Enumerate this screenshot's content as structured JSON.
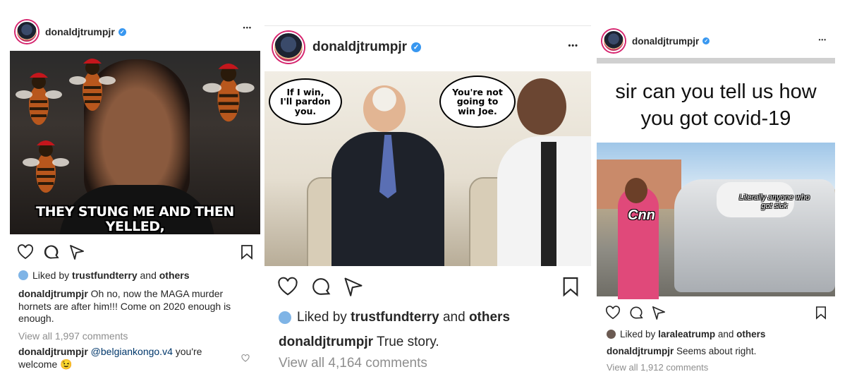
{
  "posts": [
    {
      "username": "donaldjtrumpjr",
      "more": "•••",
      "meme_caption": "THEY STUNG ME AND THEN YELLED,\n\"THIS IS MAGA COUNTRY!\"",
      "liked_prefix": "Liked by",
      "liked_user": "trustfundterry",
      "liked_and": "and",
      "liked_others": "others",
      "caption_user": "donaldjtrumpjr",
      "caption_text": "Oh no, now the MAGA murder hornets are after him!!! Come on 2020 enough is enough.",
      "view_all": "View all 1,997 comments",
      "comment_user": "donaldjtrumpjr",
      "comment_mention": "@belgiankongo.v4",
      "comment_text": "you're welcome 😉"
    },
    {
      "username": "donaldjtrumpjr",
      "more": "•••",
      "bubble_left": "If I win, I'll pardon you.",
      "bubble_right": "You're not going to win Joe.",
      "liked_prefix": "Liked by",
      "liked_user": "trustfundterry",
      "liked_and": "and",
      "liked_others": "others",
      "caption_user": "donaldjtrumpjr",
      "caption_text": "True story.",
      "view_all": "View all 4,164 comments"
    },
    {
      "username": "donaldjtrumpjr",
      "more": "•••",
      "meme_title": "sir can you tell us how you got covid-19",
      "label_cnn": "Cnn",
      "label_sick": "Literally anyone who got sick",
      "liked_prefix": "Liked by",
      "liked_user": "laraleatrump",
      "liked_and": "and",
      "liked_others": "others",
      "caption_user": "donaldjtrumpjr",
      "caption_text": "Seems about right.",
      "view_all": "View all 1,912 comments"
    }
  ],
  "colors": {
    "verified": "#3897f0",
    "muted": "#8e8e8e",
    "text": "#262626",
    "link": "#00376b"
  }
}
